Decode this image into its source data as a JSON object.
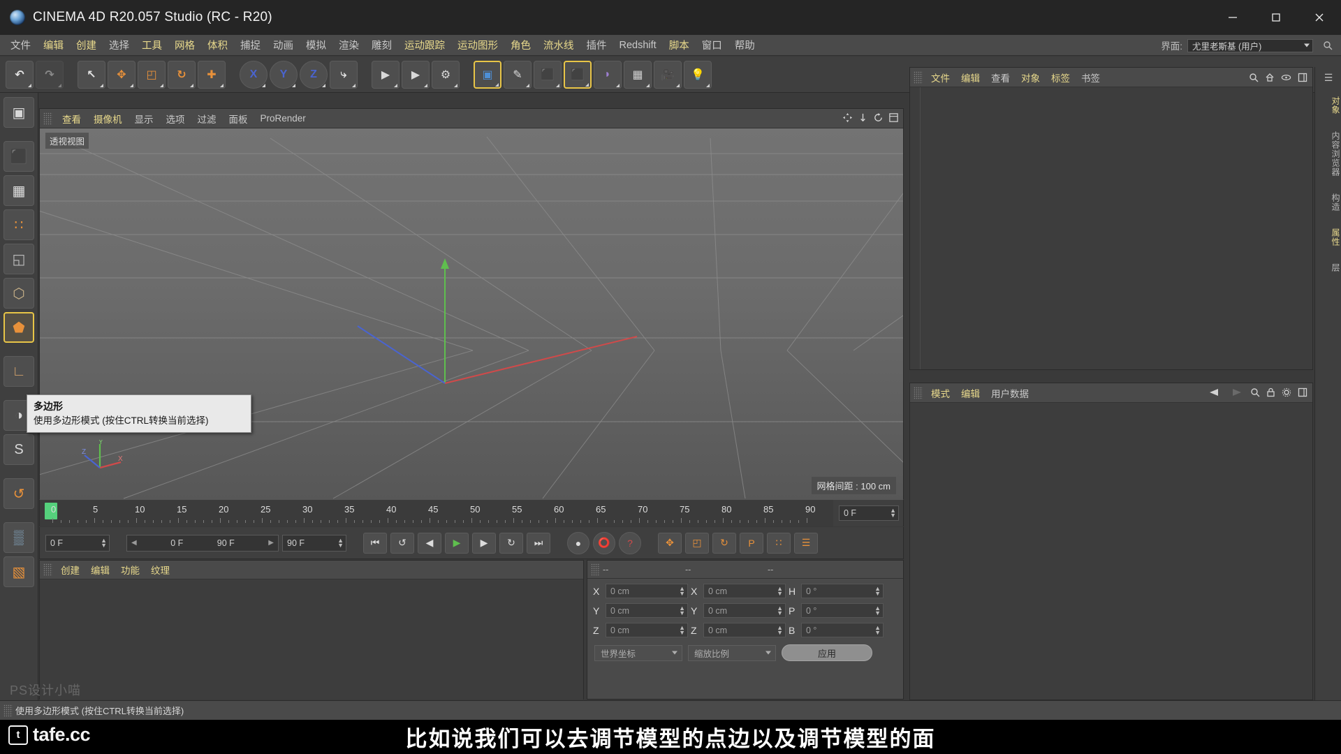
{
  "window": {
    "title": "CINEMA 4D R20.057 Studio (RC - R20)",
    "logo_icon": "c4d-logo-icon",
    "minimize_label": "–",
    "maximize_label": "□",
    "close_label": "✕"
  },
  "menubar": {
    "items": [
      {
        "label": "文件",
        "hl": false
      },
      {
        "label": "编辑",
        "hl": true
      },
      {
        "label": "创建",
        "hl": true
      },
      {
        "label": "选择",
        "hl": false
      },
      {
        "label": "工具",
        "hl": true
      },
      {
        "label": "网格",
        "hl": true
      },
      {
        "label": "体积",
        "hl": true
      },
      {
        "label": "捕捉",
        "hl": false
      },
      {
        "label": "动画",
        "hl": false
      },
      {
        "label": "模拟",
        "hl": false
      },
      {
        "label": "渲染",
        "hl": false
      },
      {
        "label": "雕刻",
        "hl": false
      },
      {
        "label": "运动跟踪",
        "hl": true
      },
      {
        "label": "运动图形",
        "hl": true
      },
      {
        "label": "角色",
        "hl": true
      },
      {
        "label": "流水线",
        "hl": true
      },
      {
        "label": "插件",
        "hl": false
      },
      {
        "label": "Redshift",
        "hl": false
      },
      {
        "label": "脚本",
        "hl": true
      },
      {
        "label": "窗口",
        "hl": false
      },
      {
        "label": "帮助",
        "hl": false
      }
    ],
    "interface_label": "界面:",
    "interface_value": "尤里老斯基 (用户)",
    "search_icon": "search-icon"
  },
  "toolbar": {
    "buttons": [
      {
        "name": "undo-button",
        "glyph": "↶",
        "style": "plain",
        "dim": false
      },
      {
        "name": "redo-button",
        "glyph": "↷",
        "style": "plain",
        "dim": true
      },
      {
        "name": "select-tool-button",
        "glyph": "↖",
        "style": "plain",
        "dim": false
      },
      {
        "name": "move-tool-button",
        "glyph": "✥",
        "style": "accent",
        "dim": false
      },
      {
        "name": "scale-tool-button",
        "glyph": "◰",
        "style": "accent",
        "dim": false
      },
      {
        "name": "rotate-tool-button",
        "glyph": "↻",
        "style": "accent",
        "dim": false
      },
      {
        "name": "transform-tool-button",
        "glyph": "✚",
        "style": "accent",
        "dim": false
      },
      {
        "name": "lock-x-axis-button",
        "glyph": "X",
        "style": "axis-x",
        "dim": false
      },
      {
        "name": "lock-y-axis-button",
        "glyph": "Y",
        "style": "axis-y",
        "dim": false
      },
      {
        "name": "lock-z-axis-button",
        "glyph": "Z",
        "style": "axis-z",
        "dim": false
      },
      {
        "name": "world-object-coordinate-button",
        "glyph": "⤷",
        "style": "plain",
        "dim": false
      },
      {
        "name": "render-view-button",
        "glyph": "▶",
        "style": "film",
        "dim": false
      },
      {
        "name": "render-region-button",
        "glyph": "▶",
        "style": "film",
        "dim": false
      },
      {
        "name": "render-settings-button",
        "glyph": "⚙",
        "style": "film",
        "dim": false
      },
      {
        "name": "add-cube-object-button",
        "glyph": "▣",
        "style": "blue-cube",
        "dim": false
      },
      {
        "name": "add-spline-button",
        "glyph": "✎",
        "style": "pen",
        "dim": false
      },
      {
        "name": "add-generator-button",
        "glyph": "⬛",
        "style": "green-cube",
        "dim": false
      },
      {
        "name": "add-array-button",
        "glyph": "⬛",
        "style": "green-cube-sel",
        "dim": false
      },
      {
        "name": "add-deformer-button",
        "glyph": "◗",
        "style": "violet",
        "dim": false
      },
      {
        "name": "add-scene-object-button",
        "glyph": "▦",
        "style": "env",
        "dim": false
      },
      {
        "name": "add-camera-button",
        "glyph": "🎥",
        "style": "camera",
        "dim": false
      },
      {
        "name": "add-light-button",
        "glyph": "💡",
        "style": "light",
        "dim": false
      }
    ]
  },
  "left_palette": {
    "buttons": [
      {
        "name": "make-editable-button",
        "icon": "make-editable-icon",
        "selected": false
      },
      {
        "name": "model-mode-button",
        "icon": "cube-model-icon",
        "selected": false
      },
      {
        "name": "texture-mode-button",
        "icon": "checker-texture-icon",
        "selected": false
      },
      {
        "name": "points-mode-button",
        "icon": "points-mesh-icon",
        "selected": false
      },
      {
        "name": "edges-mode-button",
        "icon": "edges-cube-icon",
        "selected": false
      },
      {
        "name": "polygons-top-button",
        "icon": "polygon-cube-icon",
        "selected": false
      },
      {
        "name": "polygon-mode-button",
        "icon": "polygon-orange-icon",
        "selected": true
      },
      {
        "name": "axis-mode-button",
        "icon": "axis-l-icon",
        "selected": false
      },
      {
        "name": "enable-snap-button",
        "icon": "magnet-icon",
        "selected": false
      },
      {
        "name": "workplane-button",
        "icon": "s-circle-icon",
        "selected": false
      },
      {
        "name": "enable-axis-button",
        "icon": "rotate-axis-icon",
        "selected": false
      },
      {
        "name": "uv-points-button",
        "icon": "uv-mesh-icon",
        "selected": false
      },
      {
        "name": "uv-polygons-button",
        "icon": "uv-polygon-icon",
        "selected": false
      }
    ]
  },
  "viewport": {
    "menu_items": [
      {
        "label": "查看",
        "hl": true
      },
      {
        "label": "摄像机",
        "hl": true
      },
      {
        "label": "显示",
        "hl": false
      },
      {
        "label": "选项",
        "hl": false
      },
      {
        "label": "过滤",
        "hl": false
      },
      {
        "label": "面板",
        "hl": false
      },
      {
        "label": "ProRender",
        "hl": false
      }
    ],
    "view_label": "透视视图",
    "grid_info": "网格间距 : 100 cm",
    "axis_labels": {
      "x": "X",
      "y": "Y",
      "z": "Z"
    },
    "axis_colors": {
      "x": "#d04a4a",
      "y": "#5fbf4e",
      "z": "#4a64d0"
    },
    "nav_icons": [
      "pan-view-icon",
      "dolly-view-icon",
      "rotate-view-icon",
      "maximize-view-icon"
    ]
  },
  "tooltip": {
    "title": "多边形",
    "body": "使用多边形模式 (按住CTRL转换当前选择)"
  },
  "timeline": {
    "ticks": [
      0,
      5,
      10,
      15,
      20,
      25,
      30,
      35,
      40,
      45,
      50,
      55,
      60,
      65,
      70,
      75,
      80,
      85,
      90
    ],
    "current_frame_marker": 0,
    "current_frame_field": "0 F",
    "start_field": "0 F",
    "range_start_field": "0 F",
    "range_end_field": "90 F",
    "end_field": "90 F"
  },
  "transport": {
    "buttons": [
      {
        "name": "goto-start-button",
        "glyph": "⏮"
      },
      {
        "name": "previous-key-button",
        "glyph": "↺"
      },
      {
        "name": "step-back-button",
        "glyph": "◀"
      },
      {
        "name": "play-button",
        "glyph": "▶",
        "color": "#5fbf4e"
      },
      {
        "name": "step-forward-button",
        "glyph": "▶"
      },
      {
        "name": "next-key-button",
        "glyph": "↻"
      },
      {
        "name": "goto-end-button",
        "glyph": "⏭"
      },
      {
        "name": "autokey-toggle-button",
        "glyph": "●"
      },
      {
        "name": "record-keyframe-button",
        "glyph": "⭕",
        "color": "#d04a4a"
      },
      {
        "name": "keyframe-help-button",
        "glyph": "?",
        "color": "#d04a4a"
      },
      {
        "name": "position-key-button",
        "glyph": "✥",
        "color": "#e8913a"
      },
      {
        "name": "scale-key-button",
        "glyph": "◰",
        "color": "#e8913a"
      },
      {
        "name": "rotation-key-button",
        "glyph": "↻",
        "color": "#e8913a"
      },
      {
        "name": "parameter-key-button",
        "glyph": "P",
        "color": "#e8913a"
      },
      {
        "name": "point-level-anim-button",
        "glyph": "∷",
        "color": "#e8913a"
      },
      {
        "name": "timeline-settings-button",
        "glyph": "☰",
        "color": "#e8913a"
      }
    ]
  },
  "material_manager": {
    "menu_items": [
      {
        "label": "创建",
        "hl": true
      },
      {
        "label": "编辑",
        "hl": true
      },
      {
        "label": "功能",
        "hl": true
      },
      {
        "label": "纹理",
        "hl": true
      }
    ]
  },
  "coordinates": {
    "header": [
      "--",
      "--",
      "--"
    ],
    "rows": [
      {
        "pos_label": "X",
        "pos_value": "0 cm",
        "size_label": "X",
        "size_value": "0 cm",
        "rot_label": "H",
        "rot_value": "0 °"
      },
      {
        "pos_label": "Y",
        "pos_value": "0 cm",
        "size_label": "Y",
        "size_value": "0 cm",
        "rot_label": "P",
        "rot_value": "0 °"
      },
      {
        "pos_label": "Z",
        "pos_value": "0 cm",
        "size_label": "Z",
        "size_value": "0 cm",
        "rot_label": "B",
        "rot_value": "0 °"
      }
    ],
    "coord_system": "世界坐标",
    "scale_mode": "缩放比例",
    "apply_label": "应用"
  },
  "object_manager": {
    "menu_items": [
      {
        "label": "文件",
        "hl": true
      },
      {
        "label": "编辑",
        "hl": true
      },
      {
        "label": "查看",
        "hl": false
      },
      {
        "label": "对象",
        "hl": true
      },
      {
        "label": "标签",
        "hl": true
      },
      {
        "label": "书签",
        "hl": false
      }
    ],
    "icons": [
      "search-icon",
      "home-icon",
      "eye-icon",
      "panel-icon"
    ]
  },
  "attribute_manager": {
    "menu_items": [
      {
        "label": "模式",
        "hl": true
      },
      {
        "label": "编辑",
        "hl": true
      },
      {
        "label": "用户数据",
        "hl": false
      }
    ],
    "icons": [
      "back-arrow-icon",
      "forward-arrow-icon",
      "search-icon",
      "lock-icon",
      "gear-icon",
      "panel-icon"
    ]
  },
  "right_tabs": [
    {
      "label": "对象",
      "active": true
    },
    {
      "label": "内容浏览器",
      "active": false
    },
    {
      "label": "构造",
      "active": false
    },
    {
      "label": "属性",
      "active": true
    },
    {
      "label": "层",
      "active": false
    }
  ],
  "status_bar": {
    "text": "使用多边形模式 (按住CTRL转换当前选择)"
  },
  "watermark": "PS设计小喵",
  "branding": {
    "logo_text": "tafe.cc",
    "logo_mark": "t"
  },
  "subtitle": {
    "text": "比如说我们可以去调节模型的点边以及调节模型的面"
  },
  "colors": {
    "accent_yellow": "#e8c547",
    "axis_x": "#d04a4a",
    "axis_y": "#5fbf4e",
    "axis_z": "#4a64d0",
    "panel_bg": "#4a4a4a",
    "toolbar_bg": "#3f3f3f"
  }
}
